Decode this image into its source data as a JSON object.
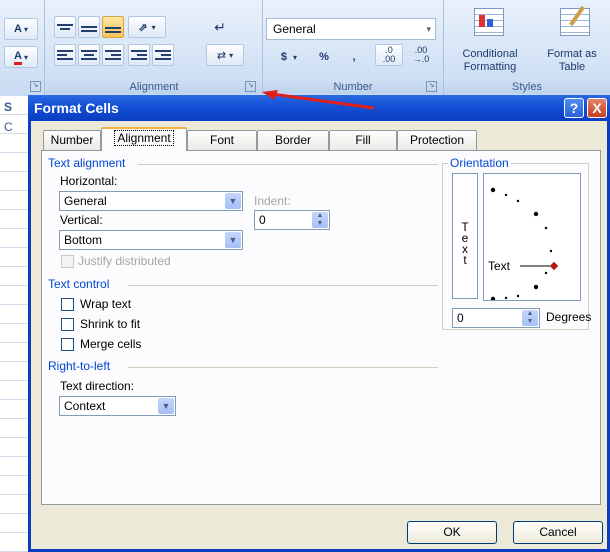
{
  "ribbon": {
    "groups": {
      "alignment_label": "Alignment",
      "number_label": "Number",
      "styles_label": "Styles"
    },
    "number_format_value": "General",
    "dollar_label": "$",
    "percent_label": "%",
    "comma_label": ",",
    "dec_increase_label": "←.0\n.00",
    "dec_increase_a": ".0",
    "dec_increase_b": ".00",
    "dec_decrease_a": ".00",
    "dec_decrease_b": "→.0",
    "left_a1": "A",
    "left_a2": "A",
    "conditional_formatting_label": "Conditional Formatting",
    "format_as_table_label": "Format as Table",
    "sheet_strip_letter": "S",
    "sheet_strip_letter2": "C"
  },
  "dialog": {
    "title": "Format Cells",
    "help_label": "?",
    "close_label": "X",
    "tabs": [
      {
        "label": "Number"
      },
      {
        "label": "Alignment"
      },
      {
        "label": "Font"
      },
      {
        "label": "Border"
      },
      {
        "label": "Fill"
      },
      {
        "label": "Protection"
      }
    ],
    "text_alignment": {
      "section_label": "Text alignment",
      "horizontal_label": "Horizontal:",
      "horizontal_value": "General",
      "vertical_label": "Vertical:",
      "vertical_value": "Bottom",
      "indent_label": "Indent:",
      "indent_value": "0",
      "justify_distributed_label": "Justify distributed"
    },
    "text_control": {
      "section_label": "Text control",
      "wrap_text_label": "Wrap text",
      "shrink_to_fit_label": "Shrink to fit",
      "merge_cells_label": "Merge cells"
    },
    "right_to_left": {
      "section_label": "Right-to-left",
      "text_direction_label": "Text direction:",
      "text_direction_value": "Context"
    },
    "orientation": {
      "section_label": "Orientation",
      "vertical_text": [
        "T",
        "e",
        "x",
        "t"
      ],
      "dial_text": "Text",
      "degrees_value": "0",
      "degrees_label": "Degrees"
    },
    "ok_label": "OK",
    "cancel_label": "Cancel"
  },
  "colors": {
    "accent_blue": "#0046d5",
    "title_blue": "#0a3dc2",
    "arrow_red": "#e0201a",
    "dialog_face": "#ece9d8"
  }
}
